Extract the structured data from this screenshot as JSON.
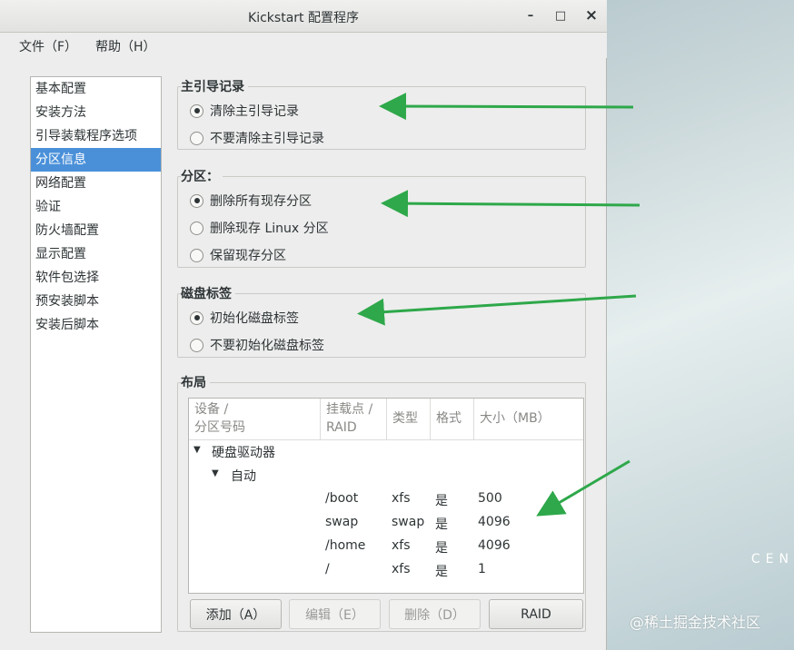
{
  "window": {
    "title": "Kickstart 配置程序",
    "controls": {
      "minimize": "–",
      "maximize": "□",
      "close": "×"
    }
  },
  "menu": {
    "file": "文件（F）",
    "help": "帮助（H）"
  },
  "sidebar": {
    "items": [
      {
        "label": "基本配置"
      },
      {
        "label": "安装方法"
      },
      {
        "label": "引导装载程序选项"
      },
      {
        "label": "分区信息",
        "selected": true
      },
      {
        "label": "网络配置"
      },
      {
        "label": "验证"
      },
      {
        "label": "防火墙配置"
      },
      {
        "label": "显示配置"
      },
      {
        "label": "软件包选择"
      },
      {
        "label": "预安装脚本"
      },
      {
        "label": "安装后脚本"
      }
    ]
  },
  "mbr": {
    "title": "主引导记录",
    "options": [
      {
        "label": "清除主引导记录",
        "checked": true
      },
      {
        "label": "不要清除主引导记录",
        "checked": false
      }
    ]
  },
  "partitions": {
    "title": "分区：",
    "options": [
      {
        "label": "删除所有现存分区",
        "checked": true
      },
      {
        "label": "删除现存  Linux 分区",
        "checked": false
      },
      {
        "label": "保留现存分区",
        "checked": false
      }
    ]
  },
  "disklabel": {
    "title": "磁盘标签",
    "options": [
      {
        "label": "初始化磁盘标签",
        "checked": true
      },
      {
        "label": "不要初始化磁盘标签",
        "checked": false
      }
    ]
  },
  "layout": {
    "title": "布局",
    "columns": {
      "device_line1": "设备 /",
      "device_line2": "分区号码",
      "mount_line1": "挂载点 /",
      "mount_line2": "RAID",
      "type": "类型",
      "format": "格式",
      "size": "大小（MB）"
    },
    "tree": {
      "root": "硬盘驱动器",
      "child": "自动",
      "rows": [
        {
          "mount": "/boot",
          "type": "xfs",
          "format": "是",
          "size": "500"
        },
        {
          "mount": "swap",
          "type": "swap",
          "format": "是",
          "size": "4096"
        },
        {
          "mount": "/home",
          "type": "xfs",
          "format": "是",
          "size": "4096"
        },
        {
          "mount": "/",
          "type": "xfs",
          "format": "是",
          "size": "1"
        }
      ]
    },
    "buttons": {
      "add": "添加（A）",
      "edit": "编辑（E）",
      "delete": "删除（D）",
      "raid": "RAID"
    }
  },
  "desktop": {
    "logo_text": "CEN",
    "watermark": "@稀土掘金技术社区"
  },
  "colors": {
    "selection": "#4a90d9",
    "arrow": "#2ea84a"
  }
}
